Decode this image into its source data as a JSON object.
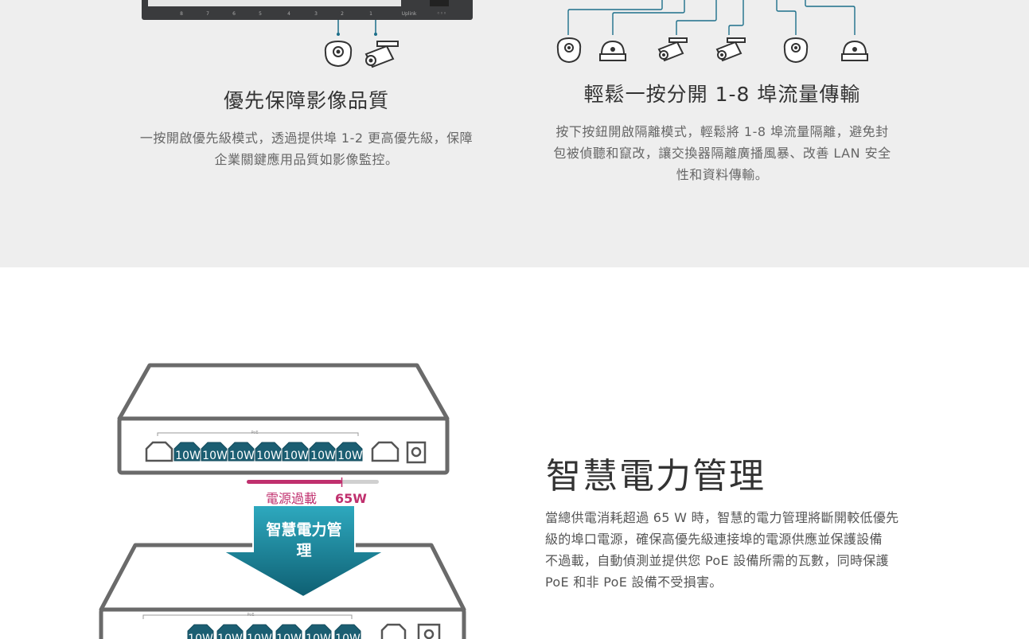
{
  "top_left": {
    "port_numbers": [
      "8",
      "7",
      "6",
      "5",
      "4",
      "3",
      "2",
      "1"
    ],
    "uplink_label": "Uplink",
    "title": "優先保障影像品質",
    "text_lines": [
      "一按開啟優先級模式，透過提供埠 1-2 更高優先級，保障",
      "企業關鍵應用品質如影像監控。"
    ]
  },
  "top_right": {
    "title": "輕鬆一按分開 1-8 埠流量傳輸",
    "text_lines": [
      "按下按鈕開啟隔離模式，輕鬆將 1-8 埠流量隔離，避免封",
      "包被偵聽和竄改，讓交換器隔離廣播風暴、改善 LAN 安全",
      "性和資料傳輸。"
    ]
  },
  "power": {
    "poe_label": "PoE",
    "port_watt": [
      "10W",
      "10W",
      "10W",
      "10W",
      "10W",
      "10W",
      "10W"
    ],
    "overload_label": "電源過載",
    "overload_value": "65W",
    "budget_fill_fraction": 0.72,
    "arrow_label_lines": [
      "智慧電力管",
      "理"
    ],
    "title": "智慧電力管理",
    "text_lines": [
      "當總供電消耗超過 65 W 時，智慧的電力管理將斷開較低優先",
      "級的埠口電源，確保高優先級連接埠的電源供應並保護設備",
      "不過載，自動偵測並提供您 PoE 設備所需的瓦數，同時保護",
      "PoE 和非 PoE 設備不受損害。"
    ],
    "colors": {
      "accent": "#c0306e",
      "teal": "#1a8aa0",
      "teal_dark": "#0e5f72",
      "port": "#1b5e72"
    }
  }
}
